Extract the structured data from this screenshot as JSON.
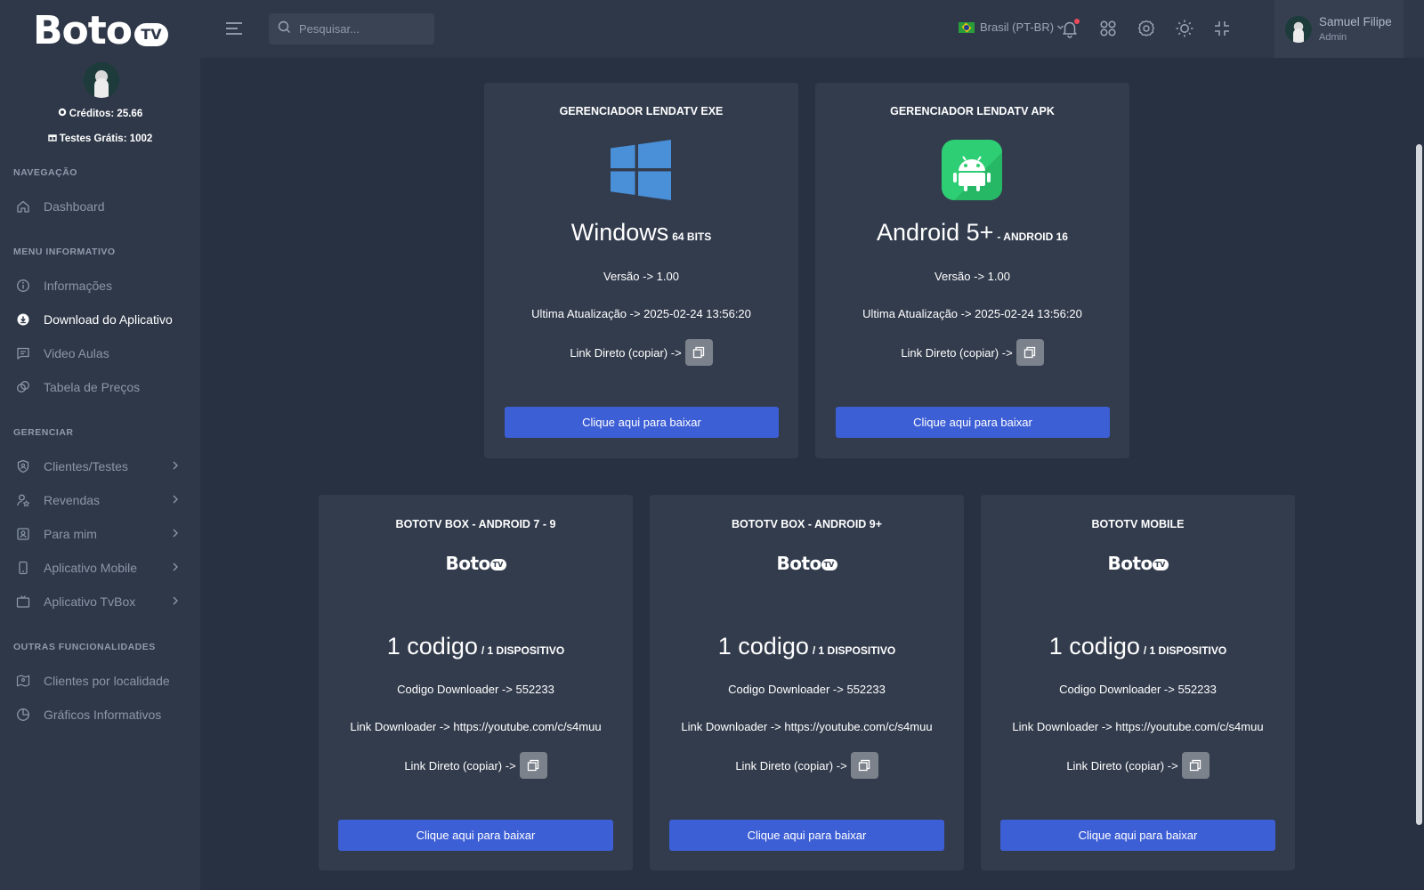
{
  "brand": {
    "logo_word": "Boto",
    "logo_badge": "TV"
  },
  "sidebar": {
    "credits": "Créditos: 25.66",
    "trials": "Testes Grátis: 1002",
    "sections": {
      "nav": "NAVEGAÇÃO",
      "menu": "MENU INFORMATIVO",
      "manage": "GERENCIAR",
      "other": "OUTRAS FUNCIONALIDADES"
    },
    "items": [
      {
        "label": "Dashboard",
        "icon": "home-icon"
      },
      {
        "label": "Informações",
        "icon": "info-icon"
      },
      {
        "label": "Download do Aplicativo",
        "icon": "download-cloud-icon",
        "active": true
      },
      {
        "label": "Video Aulas",
        "icon": "message-icon"
      },
      {
        "label": "Tabela de Preços",
        "icon": "coins-icon"
      },
      {
        "label": "Clientes/Testes",
        "icon": "shield-user-icon"
      },
      {
        "label": "Revendas",
        "icon": "user-star-icon"
      },
      {
        "label": "Para mim",
        "icon": "user-badge-icon"
      },
      {
        "label": "Aplicativo Mobile",
        "icon": "phone-icon"
      },
      {
        "label": "Aplicativo TvBox",
        "icon": "tv-icon"
      },
      {
        "label": "Clientes por localidade",
        "icon": "map-icon"
      },
      {
        "label": "Gráficos Informativos",
        "icon": "pie-chart-icon"
      }
    ]
  },
  "topbar": {
    "search_placeholder": "Pesquisar...",
    "language": "Brasil (PT-BR)",
    "user_name": "Samuel Filipe",
    "user_role": "Admin"
  },
  "cards_top": [
    {
      "title": "GERENCIADOR LENDATV EXE",
      "platform": "Windows",
      "platform_sub": "64 BITS",
      "version": "Versão -> 1.00",
      "updated": "Ultima Atualização -> 2025-02-24 13:56:20",
      "link_label": "Link Direto (copiar) ->",
      "button": "Clique aqui para baixar",
      "icon": "windows-icon"
    },
    {
      "title": "GERENCIADOR LENDATV APK",
      "platform": "Android 5+",
      "platform_sub": "- ANDROID 16",
      "version": "Versão -> 1.00",
      "updated": "Ultima Atualização -> 2025-02-24 13:56:20",
      "link_label": "Link Direto (copiar) ->",
      "button": "Clique aqui para baixar",
      "icon": "android-icon"
    }
  ],
  "cards_bottom": [
    {
      "title": "BOTOTV BOX - ANDROID 7 - 9",
      "code_main": "1 codigo",
      "code_sub": "/ 1 DISPOSITIVO",
      "downloader_code": "Codigo Downloader -> 552233",
      "downloader_link": "Link Downloader -> https://youtube.com/c/s4muu",
      "link_label": "Link Direto (copiar) ->",
      "button": "Clique aqui para baixar"
    },
    {
      "title": "BOTOTV BOX - ANDROID 9+",
      "code_main": "1 codigo",
      "code_sub": "/ 1 DISPOSITIVO",
      "downloader_code": "Codigo Downloader -> 552233",
      "downloader_link": "Link Downloader -> https://youtube.com/c/s4muu",
      "link_label": "Link Direto (copiar) ->",
      "button": "Clique aqui para baixar"
    },
    {
      "title": "BOTOTV MOBILE",
      "code_main": "1 codigo",
      "code_sub": "/ 1 DISPOSITIVO",
      "downloader_code": "Codigo Downloader -> 552233",
      "downloader_link": "Link Downloader -> https://youtube.com/c/s4muu",
      "link_label": "Link Direto (copiar) ->",
      "button": "Clique aqui para baixar"
    }
  ],
  "colors": {
    "accent": "#3d5fd6",
    "card": "#333c4d",
    "background": "#283141",
    "sidebar": "#2f3849"
  }
}
